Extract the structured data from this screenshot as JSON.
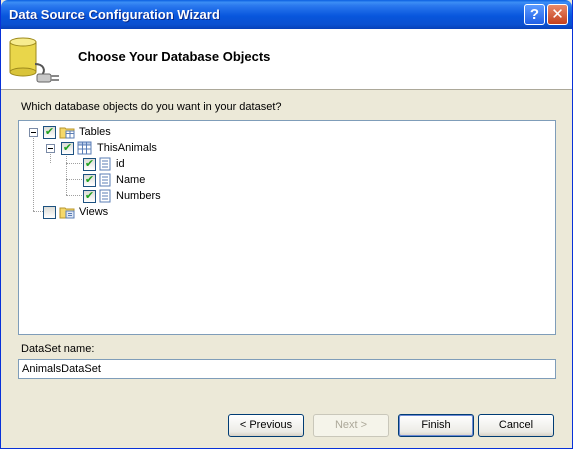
{
  "window": {
    "title": "Data Source Configuration Wizard"
  },
  "titlebar_buttons": {
    "help": "?",
    "close": "✕"
  },
  "header": {
    "title": "Choose Your Database Objects"
  },
  "prompt": "Which database objects do you want in your dataset?",
  "tree": {
    "tables": {
      "label": "Tables",
      "checked": true,
      "expanded": true
    },
    "table": {
      "label": "ThisAnimals",
      "checked": true,
      "expanded": true
    },
    "columns": [
      {
        "label": "id",
        "checked": true
      },
      {
        "label": "Name",
        "checked": true
      },
      {
        "label": "Numbers",
        "checked": true
      }
    ],
    "views": {
      "label": "Views",
      "checked": false
    }
  },
  "dataset": {
    "label": "DataSet name:",
    "value": "AnimalsDataSet"
  },
  "buttons": {
    "previous": "< Previous",
    "next": "Next >",
    "finish": "Finish",
    "cancel": "Cancel"
  },
  "check_glyph": "✔",
  "colors": {
    "title_bar": "#0856dd",
    "checkmark": "#21a121",
    "dialog_bg": "#ece9d8"
  }
}
